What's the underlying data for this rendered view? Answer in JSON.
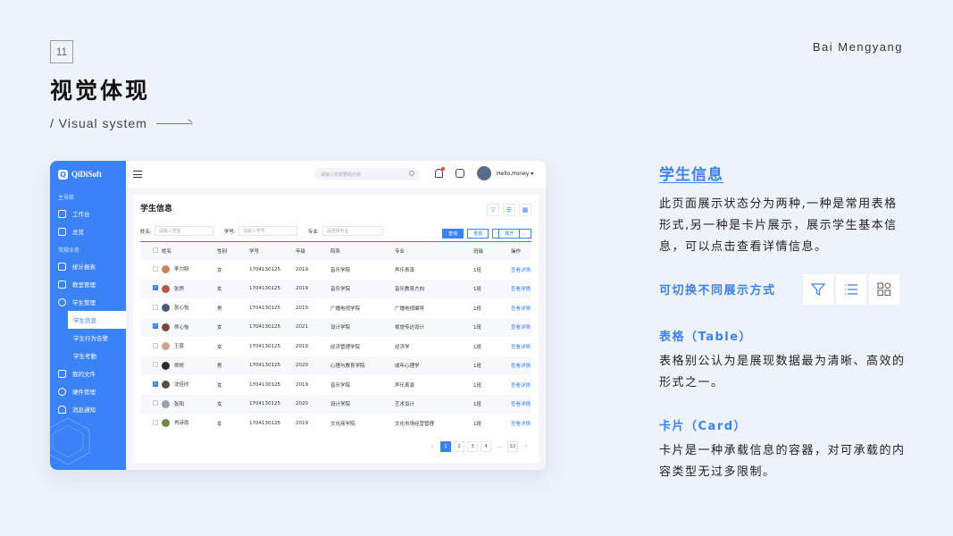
{
  "slide": {
    "page_number": "11",
    "author": "Bai Mengyang",
    "title": "视觉体现",
    "subtitle": "/ Visual system"
  },
  "app": {
    "logo": "QiDiSoft",
    "sidebar": {
      "group_main": "主导航",
      "main_items": [
        {
          "label": "工作台"
        },
        {
          "label": "总览"
        }
      ],
      "group_business": "常规业务",
      "business_items": [
        {
          "label": "统计报表"
        },
        {
          "label": "教室管理"
        },
        {
          "label": "学生管理"
        }
      ],
      "student_sub": [
        {
          "label": "学生信息"
        },
        {
          "label": "学生行为告警"
        },
        {
          "label": "学生考勤"
        }
      ],
      "other_items": [
        {
          "label": "我的文件"
        },
        {
          "label": "硬件管理"
        },
        {
          "label": "消息通知"
        }
      ]
    },
    "topbar": {
      "search_placeholder": "请输入你想要的内容",
      "user_name": "Hello,Honey"
    },
    "panel": {
      "title": "学生信息",
      "filters": [
        {
          "label": "姓名:",
          "placeholder": "请输入姓名"
        },
        {
          "label": "学号:",
          "placeholder": "请输入学号"
        },
        {
          "label": "专业:",
          "placeholder": "请选择专业"
        }
      ],
      "buttons": {
        "search": "查询",
        "reset": "重置",
        "expand": "展开"
      },
      "columns": [
        "姓名",
        "性别",
        "学号",
        "年级",
        "院系",
        "专业",
        "班级",
        "操作"
      ],
      "rows": [
        {
          "name": "李力阳",
          "gender": "女",
          "id": "1704130125",
          "grade": "2019",
          "dept": "音乐学院",
          "major": "声乐表演",
          "class": "1班",
          "action": "查看详情",
          "checked": false,
          "color": "#c9865e"
        },
        {
          "name": "张煦",
          "gender": "女",
          "id": "1704130125",
          "grade": "2019",
          "dept": "音乐学院",
          "major": "音乐教育方向",
          "class": "1班",
          "action": "查看详情",
          "checked": true,
          "color": "#b55a4a"
        },
        {
          "name": "张心怡",
          "gender": "男",
          "id": "1704130125",
          "grade": "2019",
          "dept": "广播电视学院",
          "major": "广播电视编导",
          "class": "1班",
          "action": "查看详情",
          "checked": false,
          "color": "#4d5b78"
        },
        {
          "name": "师心怡",
          "gender": "女",
          "id": "1704130125",
          "grade": "2021",
          "dept": "设计学院",
          "major": "视觉传达设计",
          "class": "1班",
          "action": "查看详情",
          "checked": true,
          "color": "#7a4a3a"
        },
        {
          "name": "王恩",
          "gender": "女",
          "id": "1704130125",
          "grade": "2019",
          "dept": "经济管理学院",
          "major": "经济学",
          "class": "1班",
          "action": "查看详情",
          "checked": false,
          "color": "#d4a08c"
        },
        {
          "name": "师桥",
          "gender": "男",
          "id": "1704130125",
          "grade": "2020",
          "dept": "心理与教育学院",
          "major": "成年心理学",
          "class": "1班",
          "action": "查看详情",
          "checked": false,
          "color": "#2b2b2b"
        },
        {
          "name": "沈佳欣",
          "gender": "女",
          "id": "1704130125",
          "grade": "2019",
          "dept": "音乐学院",
          "major": "声乐表演",
          "class": "1班",
          "action": "查看详情",
          "checked": true,
          "color": "#5a5048"
        },
        {
          "name": "张阳",
          "gender": "女",
          "id": "1704130125",
          "grade": "2020",
          "dept": "设计学院",
          "major": "艺术设计",
          "class": "1班",
          "action": "查看详情",
          "checked": false,
          "color": "#9aa0b4"
        },
        {
          "name": "肖诗雨",
          "gender": "女",
          "id": "1704130125",
          "grade": "2019",
          "dept": "文化商学院",
          "major": "文化市场经营管理",
          "class": "1班",
          "action": "查看详情",
          "checked": false,
          "color": "#6a8a4a"
        }
      ],
      "pagination": [
        "1",
        "2",
        "3",
        "4",
        "...",
        "32"
      ]
    }
  },
  "right": {
    "heading": "学生信息",
    "description": "此页面展示状态分为两种,一种是常用表格形式,另一种是卡片展示，展示学生基本信息，可以点击查看详情信息。",
    "switch_label": "可切换不同展示方式",
    "table_title": "表格（Table）",
    "table_desc": "表格别公认为是展现数据最为清晰、高效的形式之一。",
    "card_title": "卡片（Card）",
    "card_desc": "卡片是一种承载信息的容器，对可承载的内容类型无过多限制。",
    "accent": "#3b82f6"
  }
}
